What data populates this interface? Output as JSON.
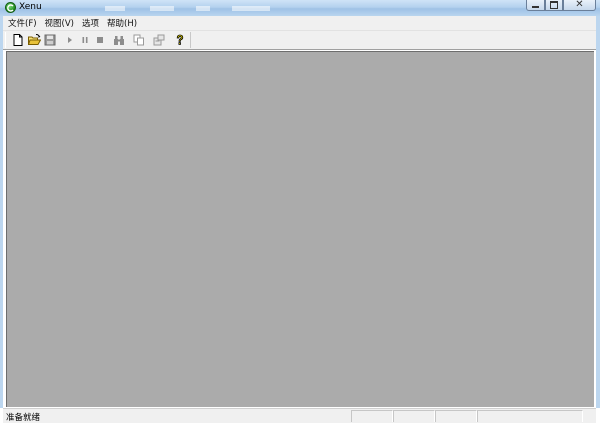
{
  "window": {
    "title": "Xenu",
    "controls": [
      "minimize-icon",
      "maximize-icon",
      "close-icon"
    ]
  },
  "menu": {
    "items": [
      {
        "label": "文件(F)"
      },
      {
        "label": "视图(V)"
      },
      {
        "label": "选项"
      },
      {
        "label": "帮助(H)"
      }
    ]
  },
  "toolbar": {
    "buttons": [
      {
        "icon": "new-file-icon",
        "enabled": true
      },
      {
        "icon": "open-folder-icon",
        "enabled": true
      },
      {
        "icon": "save-icon",
        "enabled": false
      },
      {
        "icon": "play-icon",
        "enabled": false
      },
      {
        "icon": "pause-icon",
        "enabled": false
      },
      {
        "icon": "stop-icon",
        "enabled": false
      },
      {
        "icon": "binoculars-find-icon",
        "enabled": false
      },
      {
        "icon": "copy-icon",
        "enabled": false
      },
      {
        "icon": "properties-icon",
        "enabled": false
      },
      {
        "icon": "help-icon",
        "enabled": true
      }
    ]
  },
  "client": {
    "background": "#ababab"
  },
  "status": {
    "text": "准备就绪"
  },
  "colors": {
    "titlebar": "#b4d1ee",
    "chrome": "#f0f0f0",
    "client_bg": "#ababab",
    "help_yellow": "#f2e300"
  }
}
